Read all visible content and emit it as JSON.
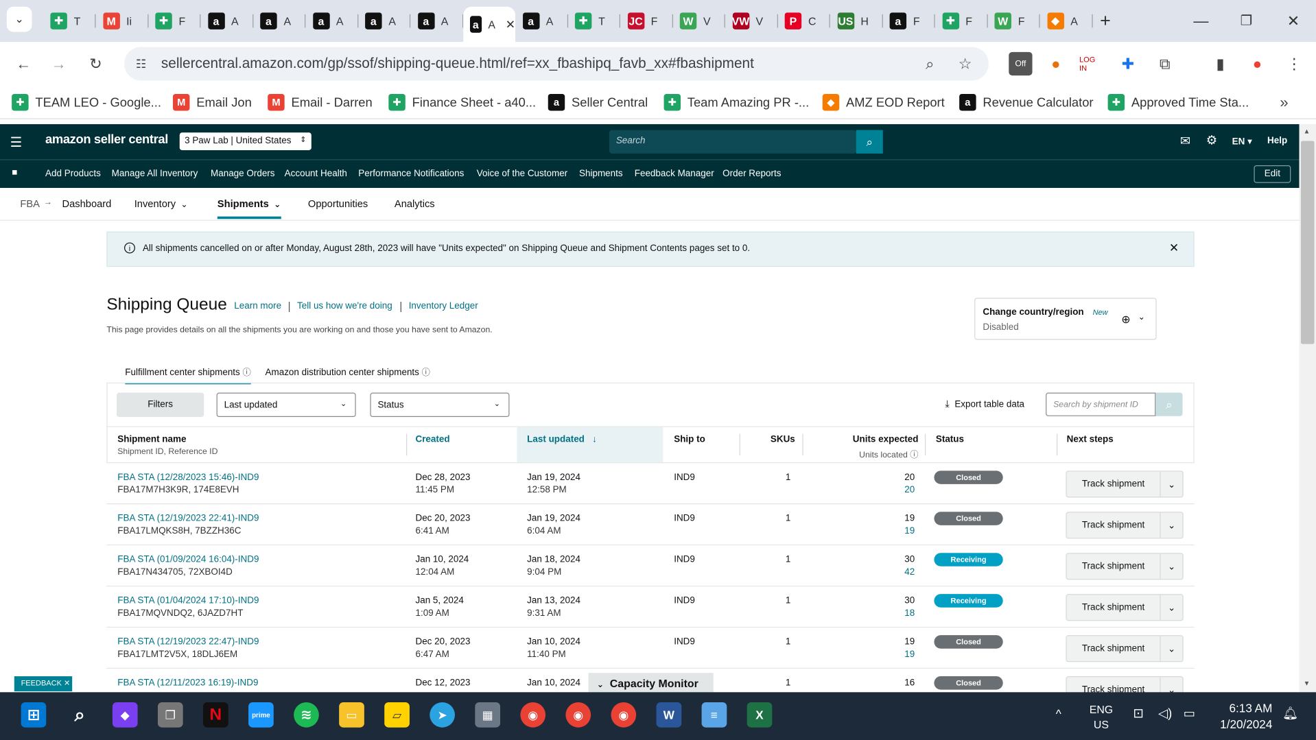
{
  "browser": {
    "tabs": [
      {
        "icon": "google-sheets-icon",
        "label": "T"
      },
      {
        "icon": "gmail-icon",
        "label": "Ii"
      },
      {
        "icon": "google-sheets-icon",
        "label": "F"
      },
      {
        "icon": "amazon-icon",
        "label": "A"
      },
      {
        "icon": "amazon-icon",
        "label": "A"
      },
      {
        "icon": "amazon-icon",
        "label": "A"
      },
      {
        "icon": "amazon-icon",
        "label": "A"
      },
      {
        "icon": "amazon-icon",
        "label": "A"
      },
      {
        "icon": "amazon-icon",
        "label": "A"
      },
      {
        "icon": "amazon-icon",
        "label": "A"
      },
      {
        "icon": "google-sheets-icon",
        "label": "T"
      },
      {
        "icon": "jc-icon",
        "label": "F"
      },
      {
        "icon": "w-icon",
        "label": "V"
      },
      {
        "icon": "vw-icon",
        "label": "V"
      },
      {
        "icon": "pinterest-icon",
        "label": "C"
      },
      {
        "icon": "usfoods-icon",
        "label": "H"
      },
      {
        "icon": "amazon-icon",
        "label": "F"
      },
      {
        "icon": "google-sheets-icon",
        "label": "F"
      },
      {
        "icon": "w-icon",
        "label": "F"
      },
      {
        "icon": "tag-icon",
        "label": "A"
      }
    ],
    "url": "sellercentral.amazon.com/gp/ssof/shipping-queue.html/ref=xx_fbashipq_favb_xx#fbashipment",
    "bookmarks": [
      {
        "icon": "google-sheets-icon",
        "label": "TEAM LEO - Google..."
      },
      {
        "icon": "gmail-icon",
        "label": "Email Jon"
      },
      {
        "icon": "gmail-icon",
        "label": "Email - Darren"
      },
      {
        "icon": "google-sheets-icon",
        "label": "Finance Sheet - a40..."
      },
      {
        "icon": "amazon-icon",
        "label": "Seller Central"
      },
      {
        "icon": "google-sheets-icon",
        "label": "Team Amazing PR -..."
      },
      {
        "icon": "tag-icon",
        "label": "AMZ EOD Report"
      },
      {
        "icon": "amazon-icon",
        "label": "Revenue Calculator"
      },
      {
        "icon": "google-sheets-icon",
        "label": "Approved Time Sta..."
      }
    ]
  },
  "header": {
    "logo": "amazon seller central",
    "account": "3 Paw Lab | United States",
    "search_placeholder": "Search",
    "language": "EN",
    "help": "Help"
  },
  "nav": {
    "items": [
      "Add Products",
      "Manage All Inventory",
      "Manage Orders",
      "Account Health",
      "Performance Notifications",
      "Voice of the Customer",
      "Shipments",
      "Feedback Manager",
      "Order Reports"
    ],
    "edit": "Edit"
  },
  "subnav": {
    "fba": "FBA",
    "items": [
      "Dashboard",
      "Inventory",
      "Shipments",
      "Opportunities",
      "Analytics"
    ]
  },
  "banner": {
    "text": "All shipments cancelled on or after Monday, August 28th, 2023 will have \"Units expected\" on Shipping Queue and Shipment Contents pages set to 0."
  },
  "page": {
    "title": "Shipping Queue",
    "links": [
      "Learn more",
      "Tell us how we're doing",
      "Inventory Ledger"
    ],
    "description": "This page provides details on all the shipments you are working on and those you have sent to Amazon.",
    "country_label": "Change country/region",
    "country_new": "New",
    "country_status": "Disabled",
    "tabs": [
      "Fulfillment center shipments",
      "Amazon distribution center shipments"
    ]
  },
  "filters": {
    "filters_button": "Filters",
    "sort_select": "Last updated",
    "status_select": "Status",
    "export": "Export table data",
    "search_placeholder": "Search by shipment ID"
  },
  "table": {
    "headers": {
      "name": "Shipment name",
      "name_sub": "Shipment ID, Reference ID",
      "created": "Created",
      "last_updated": "Last updated",
      "ship_to": "Ship to",
      "skus": "SKUs",
      "units": "Units expected",
      "units_sub": "Units located",
      "status": "Status",
      "next": "Next steps"
    },
    "rows": [
      {
        "name": "FBA STA (12/28/2023 15:46)-IND9",
        "ids": "FBA17M7H3K9R, 174E8EVH",
        "created_date": "Dec 28, 2023",
        "created_time": "11:45 PM",
        "updated_date": "Jan 19, 2024",
        "updated_time": "12:58 PM",
        "ship_to": "IND9",
        "skus": "1",
        "units_expected": "20",
        "units_located": "20",
        "status": "Closed",
        "next": "Track shipment"
      },
      {
        "name": "FBA STA (12/19/2023 22:41)-IND9",
        "ids": "FBA17LMQKS8H, 7BZZH36C",
        "created_date": "Dec 20, 2023",
        "created_time": "6:41 AM",
        "updated_date": "Jan 19, 2024",
        "updated_time": "6:04 AM",
        "ship_to": "IND9",
        "skus": "1",
        "units_expected": "19",
        "units_located": "19",
        "status": "Closed",
        "next": "Track shipment"
      },
      {
        "name": "FBA STA (01/09/2024 16:04)-IND9",
        "ids": "FBA17N434705, 72XBOI4D",
        "created_date": "Jan 10, 2024",
        "created_time": "12:04 AM",
        "updated_date": "Jan 18, 2024",
        "updated_time": "9:04 PM",
        "ship_to": "IND9",
        "skus": "1",
        "units_expected": "30",
        "units_located": "42",
        "status": "Receiving",
        "next": "Track shipment"
      },
      {
        "name": "FBA STA (01/04/2024 17:10)-IND9",
        "ids": "FBA17MQVNDQ2, 6JAZD7HT",
        "created_date": "Jan 5, 2024",
        "created_time": "1:09 AM",
        "updated_date": "Jan 13, 2024",
        "updated_time": "9:31 AM",
        "ship_to": "IND9",
        "skus": "1",
        "units_expected": "30",
        "units_located": "18",
        "status": "Receiving",
        "next": "Track shipment"
      },
      {
        "name": "FBA STA (12/19/2023 22:47)-IND9",
        "ids": "FBA17LMT2V5X, 18DLJ6EM",
        "created_date": "Dec 20, 2023",
        "created_time": "6:47 AM",
        "updated_date": "Jan 10, 2024",
        "updated_time": "11:40 PM",
        "ship_to": "IND9",
        "skus": "1",
        "units_expected": "19",
        "units_located": "19",
        "status": "Closed",
        "next": "Track shipment"
      },
      {
        "name": "FBA STA (12/11/2023 16:19)-IND9",
        "ids": "",
        "created_date": "Dec 12, 2023",
        "created_time": "",
        "updated_date": "Jan 10, 2024",
        "updated_time": "",
        "ship_to": "",
        "skus": "1",
        "units_expected": "16",
        "units_located": "",
        "status": "Closed",
        "next": "Track shipment"
      }
    ]
  },
  "overlays": {
    "feedback": "FEEDBACK",
    "capacity_monitor": "Capacity Monitor"
  },
  "taskbar": {
    "lang_top": "ENG",
    "lang_bottom": "US",
    "time": "6:13 AM",
    "date": "1/20/2024"
  },
  "colors": {
    "amazon_header": "#002f36",
    "link": "#007185",
    "closed": "#6a6f73",
    "receiving": "#02a0c4"
  }
}
